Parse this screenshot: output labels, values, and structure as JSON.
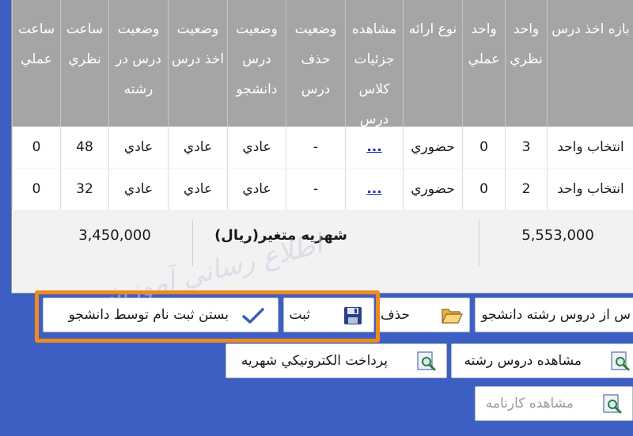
{
  "table": {
    "headers": [
      "بازه اخذ درس",
      "واحد نظري",
      "واحد عملي",
      "نوع ارائه",
      "مشاهده جزئيات كلاس درس",
      "وضعيت حذف درس",
      "وضعيت درس دانشجو",
      "وضعيت اخذ درس",
      "وضعيت درس در رشته",
      "ساعت نظري",
      "ساعت عملي"
    ],
    "rows": [
      [
        "انتخاب واحد",
        "3",
        "0",
        "حضوري",
        "...",
        "-",
        "عادي",
        "عادي",
        "عادي",
        "48",
        "0"
      ],
      [
        "انتخاب واحد",
        "2",
        "0",
        "حضوري",
        "...",
        "-",
        "عادي",
        "عادي",
        "عادي",
        "32",
        "0"
      ]
    ]
  },
  "totals": {
    "left_amount": "3,450,000",
    "label": "شهريه متغير(ريال)",
    "right_amount": "5,553,000"
  },
  "watermark": "اطلاع رساني آموزش",
  "buttons": {
    "remove_from_major": "س از دروس رشته دانشجو",
    "delete": "حذف",
    "save": "ثبت",
    "close_registration": "بستن ثبت نام توسط دانشجو",
    "view_major_courses": "مشاهده دروس رشته",
    "e_payment": "پرداخت الكترونيكي شهريه",
    "view_transcript": "مشاهده كارنامه"
  },
  "colors": {
    "background": "#3d5fc4",
    "header": "#a5a5a5",
    "highlight": "#f08a1c"
  }
}
